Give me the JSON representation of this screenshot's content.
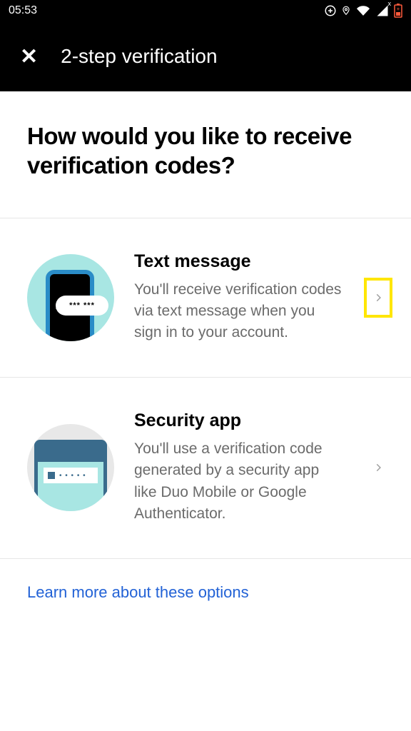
{
  "status": {
    "time": "05:53"
  },
  "header": {
    "title": "2-step verification"
  },
  "page": {
    "heading": "How would you like to receive verification codes?"
  },
  "options": {
    "text_message": {
      "title": "Text message",
      "desc": "You'll receive verification codes via text message when you sign in to your account."
    },
    "security_app": {
      "title": "Security app",
      "desc": "You'll use a verification code generated by a security app like Duo Mobile or Google Authenticator."
    }
  },
  "link": {
    "learn_more": "Learn more about these options"
  },
  "illustration": {
    "sms_placeholder": "*** ***"
  }
}
